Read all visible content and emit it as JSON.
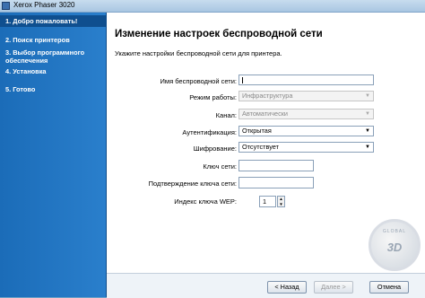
{
  "window": {
    "title": "Xerox Phaser 3020"
  },
  "sidebar": {
    "steps": [
      {
        "label": "1. Добро пожаловать!"
      },
      {
        "label": "2. Поиск принтеров"
      },
      {
        "label": "3. Выбор программного обеспечения"
      },
      {
        "label": "4. Установка"
      },
      {
        "label": "5. Готово"
      }
    ]
  },
  "main": {
    "heading": "Изменение настроек беспроводной сети",
    "subheading": "Укажите настройки беспроводной сети для принтера.",
    "fields": {
      "ssid": {
        "label": "Имя беспроводной сети:",
        "value": ""
      },
      "mode": {
        "label": "Режим работы:",
        "value": "Инфраструктура"
      },
      "channel": {
        "label": "Канал:",
        "value": "Автоматически"
      },
      "auth": {
        "label": "Аутентификация:",
        "value": "Открытая"
      },
      "encryption": {
        "label": "Шифрование:",
        "value": "Отсутствует"
      },
      "key": {
        "label": "Ключ сети:",
        "value": ""
      },
      "key_confirm": {
        "label": "Подтверждение ключа сети:",
        "value": ""
      },
      "wep_index": {
        "label": "Индекс ключа WEP:",
        "value": "1"
      }
    }
  },
  "watermark": {
    "text": "GLOBAL",
    "logo": "3D"
  },
  "buttons": {
    "back": "< Назад",
    "next": "Далее >",
    "cancel": "Отмена"
  },
  "icons": {
    "app": "printer-icon",
    "dropdown": "chevron-down-icon",
    "spin_up": "arrow-up-icon",
    "spin_down": "arrow-down-icon"
  }
}
